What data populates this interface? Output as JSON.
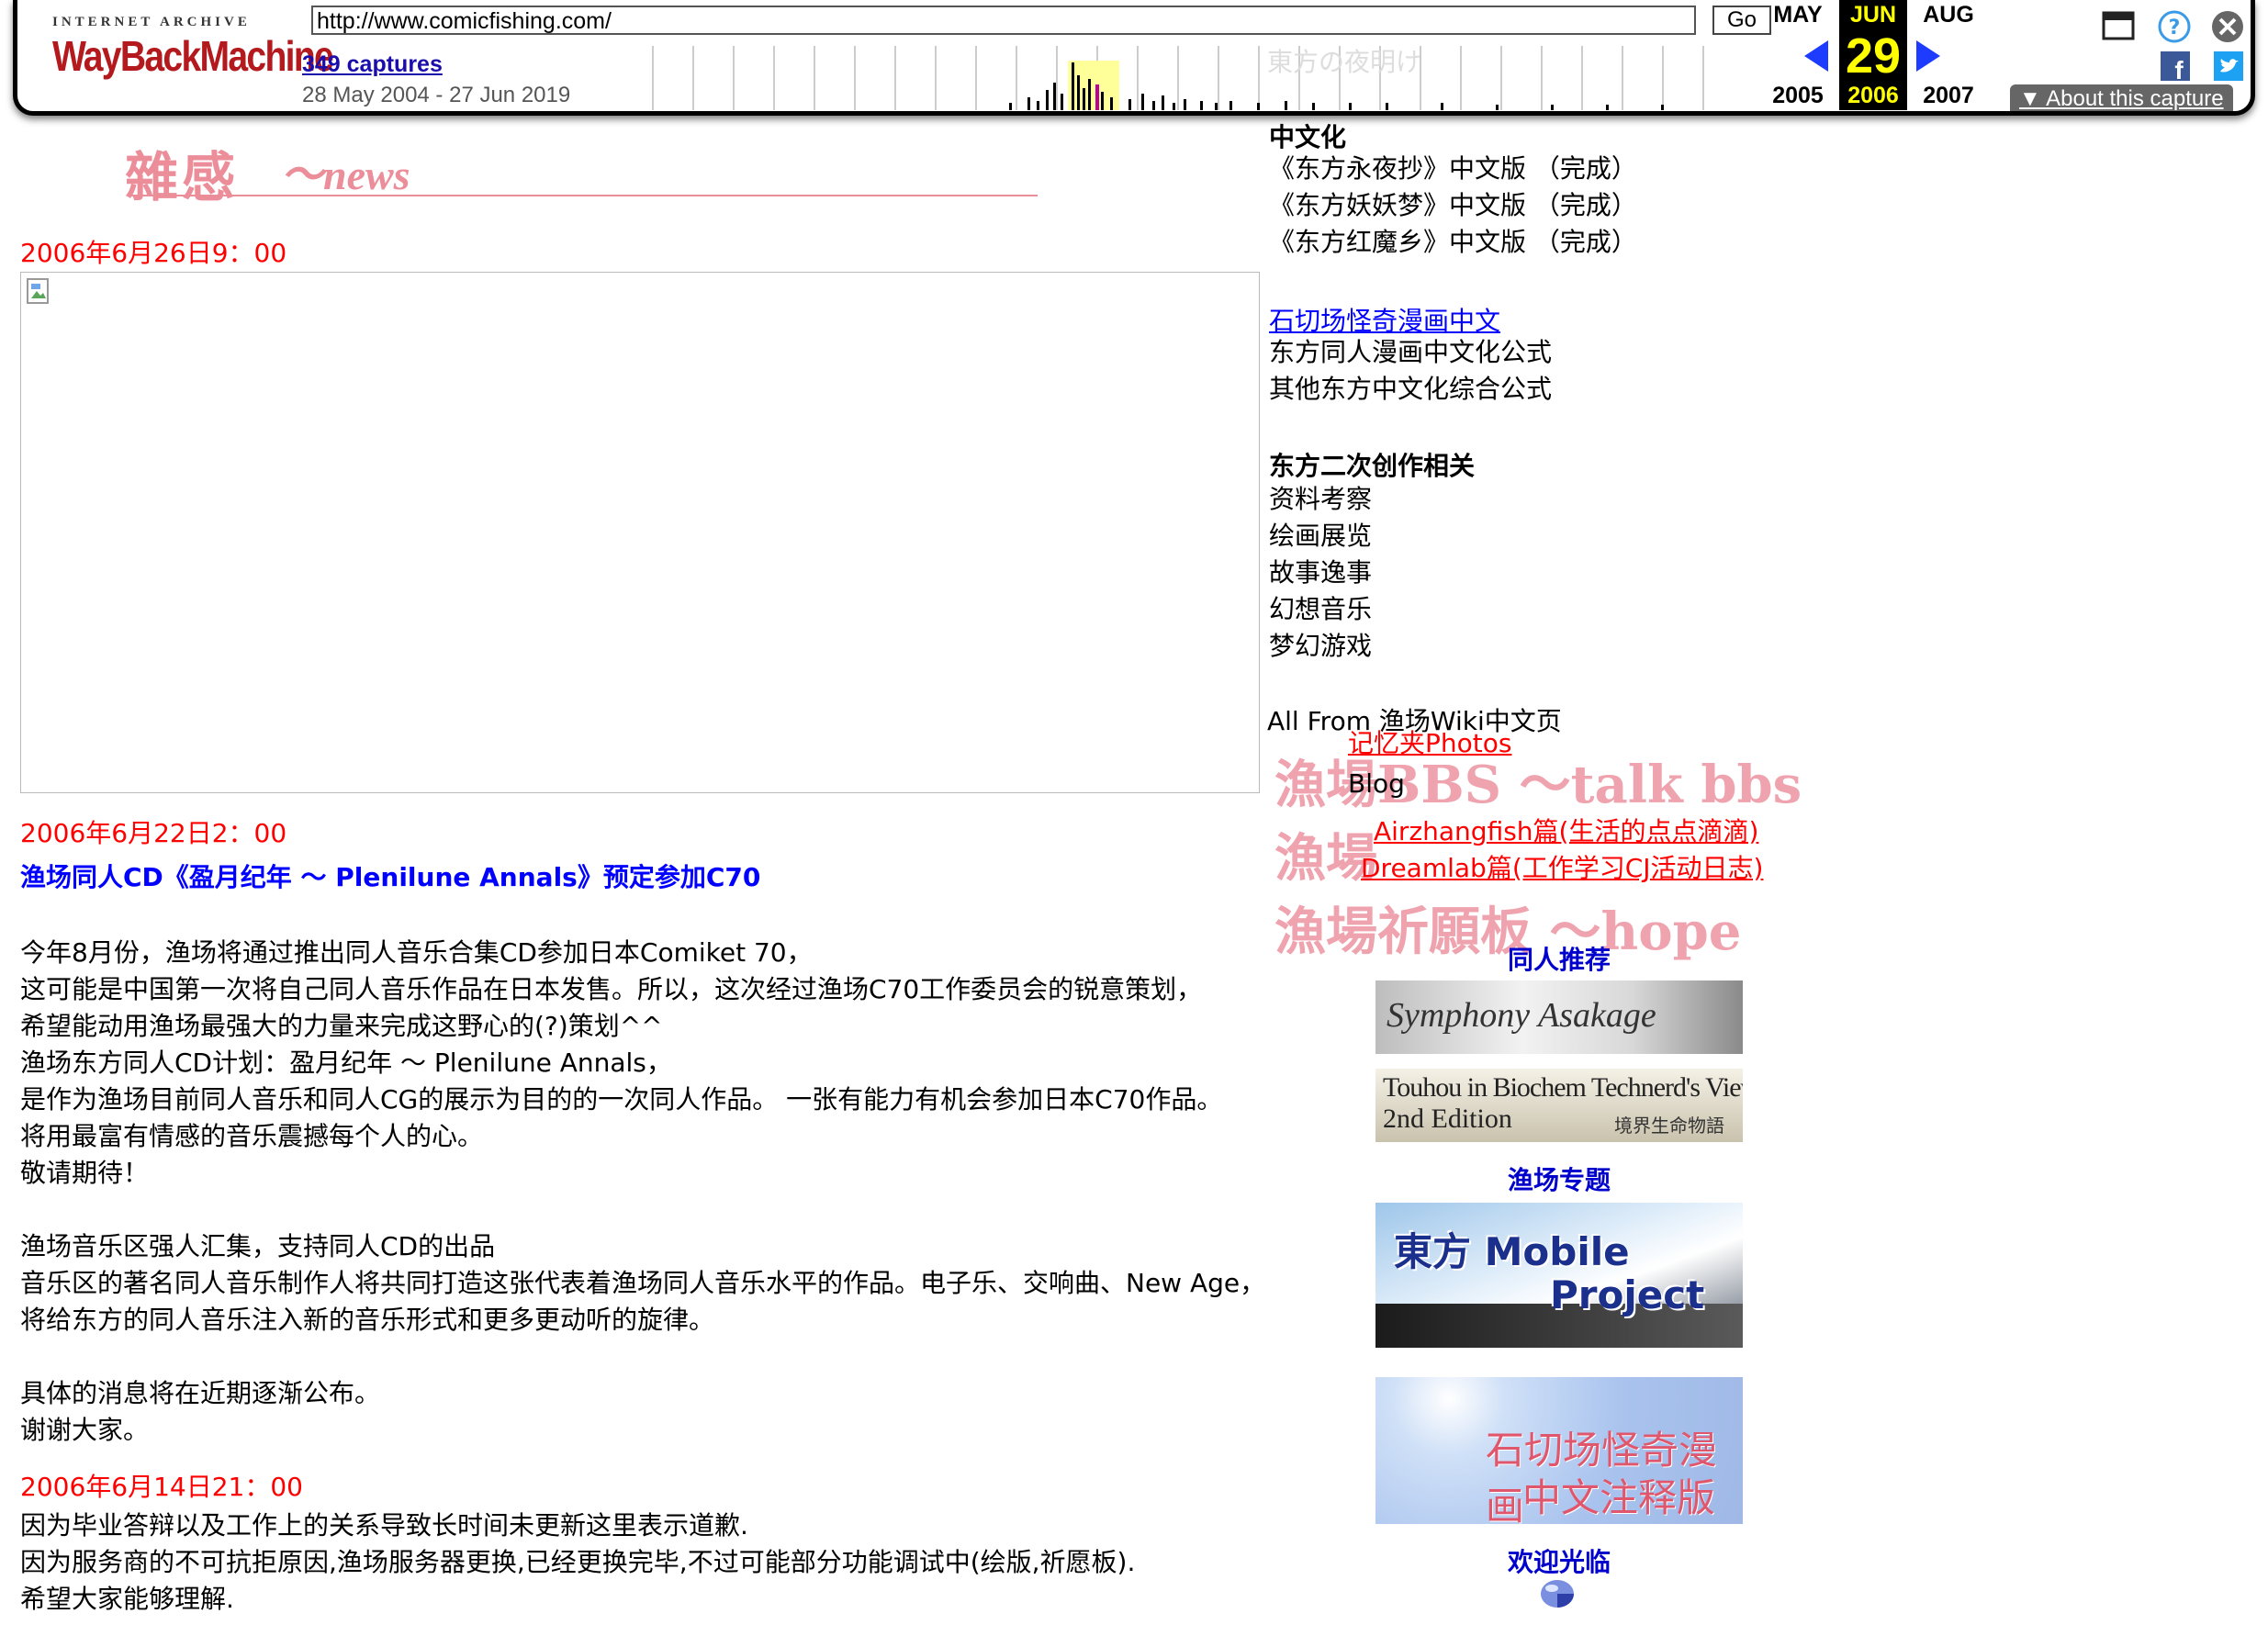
{
  "toolbar": {
    "logo_top": "INTERNET ARCHIVE",
    "logo_main": "WayBackMachine",
    "url": "http://www.comicfishing.com/",
    "go_label": "Go",
    "captures": "349 captures",
    "date_range": "28 May 2004 - 27 Jun 2019",
    "prev_month": "MAY",
    "cur_month": "JUN",
    "next_month": "AUG",
    "cur_day": "29",
    "prev_year": "2005",
    "cur_year": "2006",
    "next_year": "2007",
    "about": "About this capture",
    "accent": "#ffff00"
  },
  "header": {
    "title": "雜感",
    "subtitle": "～news"
  },
  "posts": [
    {
      "date": "2006年6月26日9：00"
    },
    {
      "date": "2006年6月22日2：00",
      "link": "渔场同人CD《盈月纪年 ～ Plenilune Annals》预定参加C70",
      "para1": "今年8月份，渔场将通过推出同人音乐合集CD参加日本Comiket 70，\n这可能是中国第一次将自己同人音乐作品在日本发售。所以，这次经过渔场C70工作委员会的锐意策划，\n希望能动用渔场最强大的力量来完成这野心的(?)策划^^\n渔场东方同人CD计划：盈月纪年 ～ Plenilune Annals，\n是作为渔场目前同人音乐和同人CG的展示为目的的一次同人作品。 一张有能力有机会参加日本C70作品。\n将用最富有情感的音乐震撼每个人的心。\n敬请期待！",
      "para2": "渔场音乐区强人汇集，支持同人CD的出品\n音乐区的著名同人音乐制作人将共同打造这张代表着渔场同人音乐水平的作品。电子乐、交响曲、New Age，\n将给东方的同人音乐注入新的音乐形式和更多更动听的旋律。",
      "para3": "具体的消息将在近期逐渐公布。\n谢谢大家。"
    },
    {
      "date": "2006年6月14日21：00",
      "para1": "因为毕业答辩以及工作上的关系导致长时间未更新这里表示道歉.\n因为服务商的不可抗拒原因,渔场服务器更换,已经更换完毕,不过可能部分功能调试中(绘版,祈愿板).\n希望大家能够理解."
    }
  ],
  "sidebar": {
    "faded_top": "東方の夜明け",
    "section1_head": "中文化",
    "section1_items": [
      "《东方永夜抄》中文版 （完成）",
      "《东方妖妖梦》中文版 （完成）",
      "《东方红魔乡》中文版 （完成）"
    ],
    "link_stone": "石切场怪奇漫画中文",
    "item_doujin": "东方同人漫画中文化公式",
    "item_other": "其他东方中文化综合公式",
    "section2_head": "东方二次创作相关",
    "section2_items": [
      "资料考察",
      "绘画展览",
      "故事逸事",
      "幻想音乐",
      "梦幻游戏"
    ],
    "all_from": "All From 渔场Wiki中文页",
    "photos": "记忆夹Photos",
    "bbs_big": "漁場BBS ～talk bbs",
    "blog": "Blog",
    "blog_big": "漁場",
    "blog_link1": "Airzhangfish篇(生活的点点滴滴)",
    "blog_link2": "Dreamlab篇(工作学习CJ活动日志)",
    "hope_big": "漁場祈願板 ～hope",
    "rec_head": "同人推荐",
    "banner1": "Symphony Asakage",
    "banner2_line1": "Touhou in Biochem Technerd's View,",
    "banner2_line2": "2nd Edition",
    "banner2_jp": "境界生命物語",
    "topic_head": "渔场专题",
    "banner3_line1": "東方 Mobile",
    "banner3_line2": "Project",
    "banner4_line1": "石切场怪奇漫画",
    "banner4_line2": "中文注释版",
    "welcome": "欢迎光临"
  }
}
